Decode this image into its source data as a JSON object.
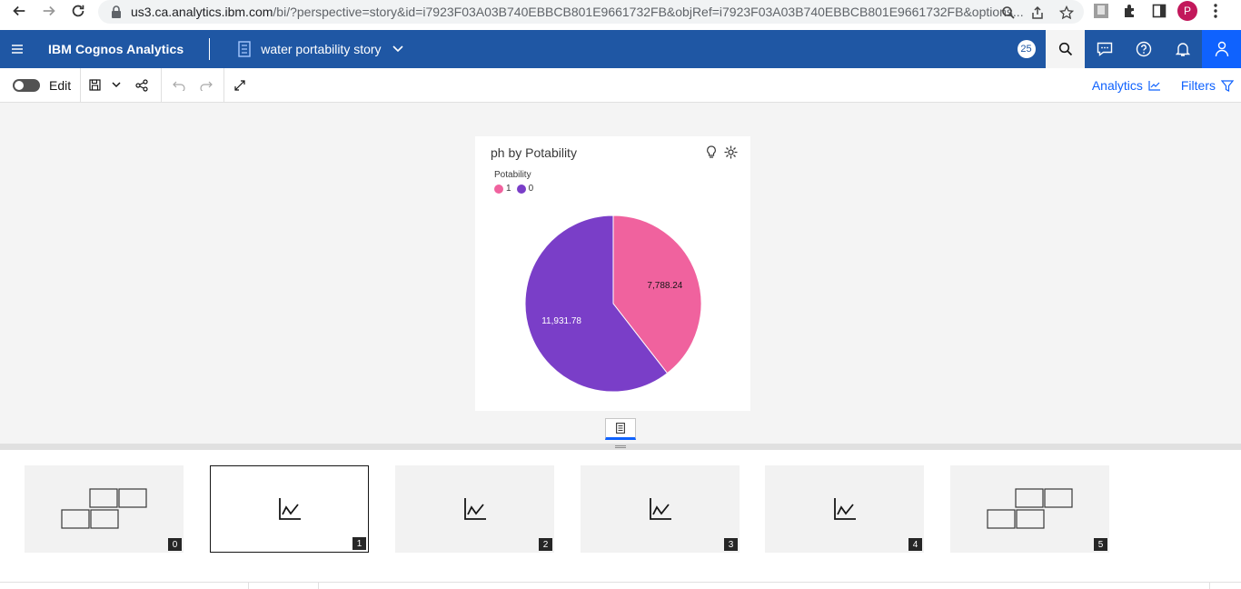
{
  "browser": {
    "url_host": "us3.ca.analytics.ibm.com",
    "url_rest": "/bi/?perspective=story&id=i7923F03A03B740EBBCB801E9661732FB&objRef=i7923F03A03B740EBBCB801E9661732FB&options...",
    "profile_initial": "P"
  },
  "header": {
    "brand": "IBM Cognos Analytics",
    "story_title": "water portability story",
    "notification_count": "25"
  },
  "toolbar": {
    "edit_label": "Edit",
    "analytics_label": "Analytics",
    "filters_label": "Filters"
  },
  "card": {
    "title": "ph by Potability"
  },
  "chart_data": {
    "type": "pie",
    "title": "ph by Potability",
    "legend_title": "Potability",
    "legend_placement": "top-left",
    "categories": [
      "1",
      "0"
    ],
    "values": [
      7788.24,
      11931.78
    ],
    "labels": [
      "7,788.24",
      "11,931.78"
    ],
    "colors": [
      "#f0629e",
      "#7a3ec8"
    ]
  },
  "scenes": [
    {
      "num": "0",
      "kind": "layout",
      "selected": false
    },
    {
      "num": "1",
      "kind": "chart",
      "selected": true
    },
    {
      "num": "2",
      "kind": "chart",
      "selected": false
    },
    {
      "num": "3",
      "kind": "chart",
      "selected": false
    },
    {
      "num": "4",
      "kind": "chart",
      "selected": false
    },
    {
      "num": "5",
      "kind": "layout",
      "selected": false
    }
  ]
}
